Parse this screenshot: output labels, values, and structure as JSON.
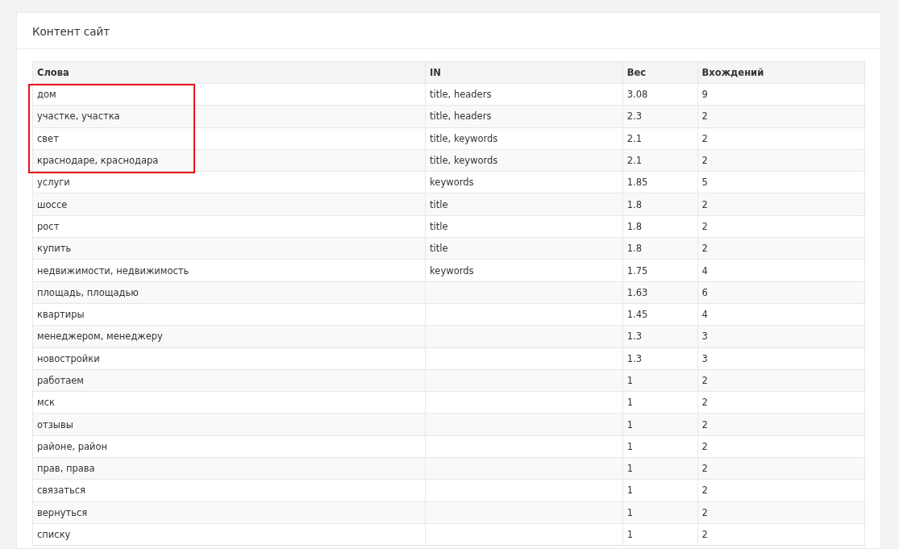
{
  "panel": {
    "title": "Контент сайт"
  },
  "table": {
    "columns": [
      "Слова",
      "IN",
      "Вес",
      "Вхождений"
    ],
    "rows": [
      {
        "cells": [
          "дом",
          "title, headers",
          "3.08",
          "9"
        ],
        "highlighted": true
      },
      {
        "cells": [
          "участке, участка",
          "title, headers",
          "2.3",
          "2"
        ],
        "highlighted": true
      },
      {
        "cells": [
          "свет",
          "title, keywords",
          "2.1",
          "2"
        ],
        "highlighted": true
      },
      {
        "cells": [
          "краснодаре, краснодара",
          "title, keywords",
          "2.1",
          "2"
        ],
        "highlighted": true
      },
      {
        "cells": [
          "услуги",
          "keywords",
          "1.85",
          "5"
        ],
        "highlighted": false
      },
      {
        "cells": [
          "шоссе",
          "title",
          "1.8",
          "2"
        ],
        "highlighted": false
      },
      {
        "cells": [
          "рост",
          "title",
          "1.8",
          "2"
        ],
        "highlighted": false
      },
      {
        "cells": [
          "купить",
          "title",
          "1.8",
          "2"
        ],
        "highlighted": false
      },
      {
        "cells": [
          "недвижимости, недвижимость",
          "keywords",
          "1.75",
          "4"
        ],
        "highlighted": false
      },
      {
        "cells": [
          "площадь, площадью",
          "",
          "1.63",
          "6"
        ],
        "highlighted": false
      },
      {
        "cells": [
          "квартиры",
          "",
          "1.45",
          "4"
        ],
        "highlighted": false
      },
      {
        "cells": [
          "менеджером, менеджеру",
          "",
          "1.3",
          "3"
        ],
        "highlighted": false
      },
      {
        "cells": [
          "новостройки",
          "",
          "1.3",
          "3"
        ],
        "highlighted": false
      },
      {
        "cells": [
          "работаем",
          "",
          "1",
          "2"
        ],
        "highlighted": false
      },
      {
        "cells": [
          "мск",
          "",
          "1",
          "2"
        ],
        "highlighted": false
      },
      {
        "cells": [
          "отзывы",
          "",
          "1",
          "2"
        ],
        "highlighted": false
      },
      {
        "cells": [
          "районе, район",
          "",
          "1",
          "2"
        ],
        "highlighted": false
      },
      {
        "cells": [
          "прав, права",
          "",
          "1",
          "2"
        ],
        "highlighted": false
      },
      {
        "cells": [
          "связаться",
          "",
          "1",
          "2"
        ],
        "highlighted": false
      },
      {
        "cells": [
          "вернуться",
          "",
          "1",
          "2"
        ],
        "highlighted": false
      },
      {
        "cells": [
          "списку",
          "",
          "1",
          "2"
        ],
        "highlighted": false
      }
    ]
  }
}
